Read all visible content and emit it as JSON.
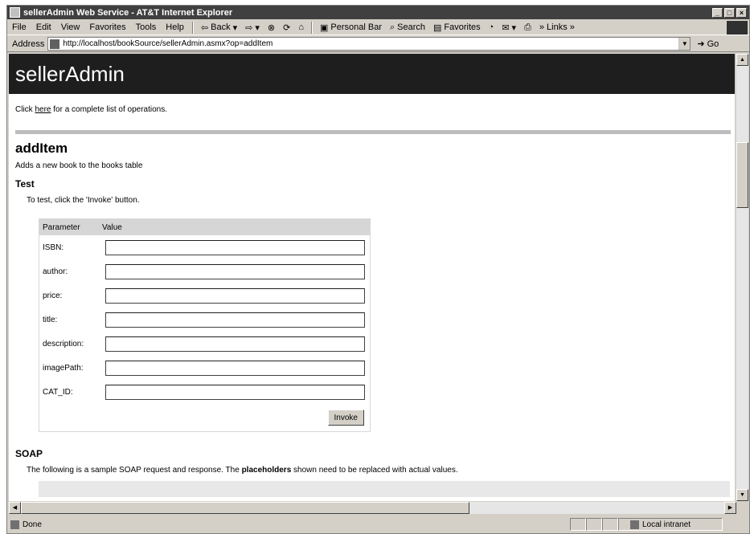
{
  "window": {
    "title": "sellerAdmin Web Service - AT&T Internet Explorer",
    "controls": [
      "_",
      "□",
      "×"
    ]
  },
  "menu": [
    "File",
    "Edit",
    "View",
    "Favorites",
    "Tools",
    "Help"
  ],
  "toolbar": {
    "back": "Back",
    "personal_bar": "Personal Bar",
    "search": "Search",
    "favorites": "Favorites",
    "links": "Links"
  },
  "address": {
    "label": "Address",
    "url": "http://localhost/bookSource/sellerAdmin.asmx?op=addItem",
    "go": "Go"
  },
  "page": {
    "banner": "sellerAdmin",
    "intro_before": "Click ",
    "intro_link": "here",
    "intro_after": " for a complete list of operations.",
    "operation": "addItem",
    "description": "Adds a new book to the books table",
    "test_heading": "Test",
    "test_hint": "To test, click the 'Invoke' button.",
    "table_headers": [
      "Parameter",
      "Value"
    ],
    "parameters": [
      "ISBN:",
      "author:",
      "price:",
      "title:",
      "description:",
      "imagePath:",
      "CAT_ID:"
    ],
    "invoke_label": "Invoke",
    "soap_heading": "SOAP",
    "soap_before": "The following is a sample SOAP request and response. The ",
    "soap_bold": "placeholders",
    "soap_after": " shown need to be replaced with actual values."
  },
  "status": {
    "text": "Done",
    "zone": "Local intranet"
  }
}
